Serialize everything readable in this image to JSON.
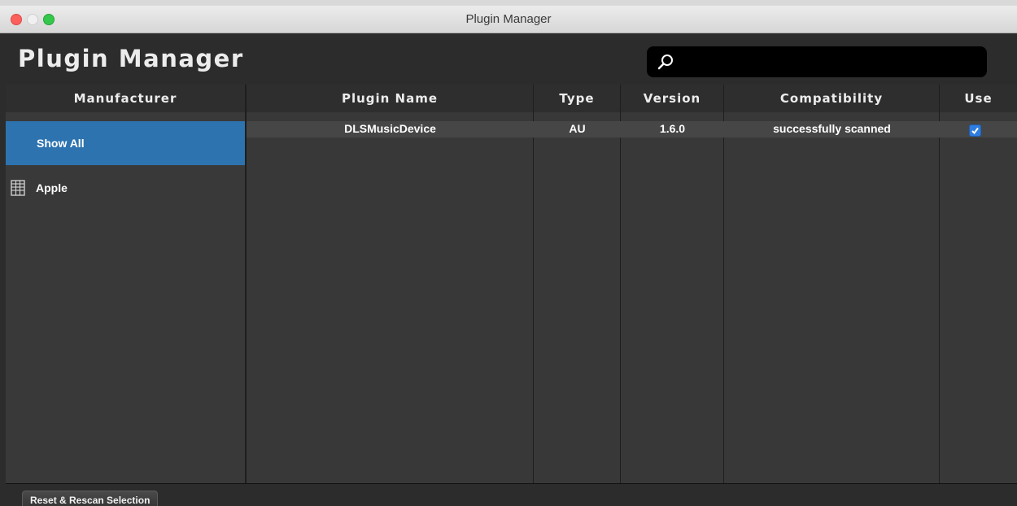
{
  "window": {
    "title": "Plugin Manager"
  },
  "header": {
    "title": "Plugin Manager",
    "search": {
      "value": "",
      "placeholder": "",
      "icon": "search-icon"
    }
  },
  "manufacturer_panel": {
    "header": "Manufacturer",
    "items": [
      {
        "label": "Show All",
        "selected": true
      },
      {
        "label": "Apple",
        "icon": "grid-icon"
      }
    ]
  },
  "plugins_table": {
    "columns": [
      "Plugin Name",
      "Type",
      "Version",
      "Compatibility",
      "Use"
    ],
    "rows": [
      {
        "name": "DLSMusicDevice",
        "type": "AU",
        "version": "1.6.0",
        "compatibility": "successfully scanned",
        "use": true
      }
    ]
  },
  "footer": {
    "rescan_label": "Reset & Rescan Selection"
  },
  "colors": {
    "accent": "#2c73b0",
    "checkbox": "#2f7de1"
  }
}
